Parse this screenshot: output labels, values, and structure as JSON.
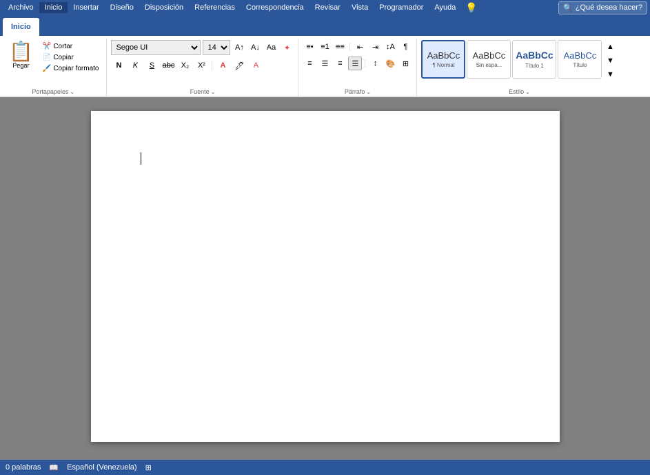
{
  "menubar": {
    "items": [
      "Archivo",
      "Inicio",
      "Insertar",
      "Diseño",
      "Disposición",
      "Referencias",
      "Correspondencia",
      "Revisar",
      "Vista",
      "Programador",
      "Ayuda"
    ]
  },
  "ribbon": {
    "active_tab": "Inicio",
    "groups": {
      "portapapeles": {
        "label": "Portapapeles",
        "paste_label": "Pegar",
        "btn_cortar": "Cortar",
        "btn_copiar": "Copiar",
        "btn_copiar_formato": "Copiar formato"
      },
      "fuente": {
        "label": "Fuente",
        "font_name": "Segoe UI",
        "font_size": "14",
        "btn_bold": "N",
        "btn_italic": "K",
        "btn_underline": "S"
      },
      "parrafo": {
        "label": "Párrafo"
      },
      "estilos": {
        "label": "Estilo",
        "styles": [
          {
            "id": "normal",
            "preview": "AaBbCc",
            "label": "¶ Normal",
            "active": true
          },
          {
            "id": "sin-espacio",
            "preview": "AaBbCc",
            "label": "Sin espa..."
          },
          {
            "id": "titulo1",
            "preview": "AaBbCc",
            "label": "Título 1"
          },
          {
            "id": "titulo2",
            "preview": "AaBbCc",
            "label": "Título"
          }
        ]
      }
    }
  },
  "help_search": {
    "placeholder": "¿Qué desea hacer?"
  },
  "status_bar": {
    "word_count": "0 palabras",
    "language": "Español (Venezuela)",
    "macro_icon": "⊞"
  }
}
